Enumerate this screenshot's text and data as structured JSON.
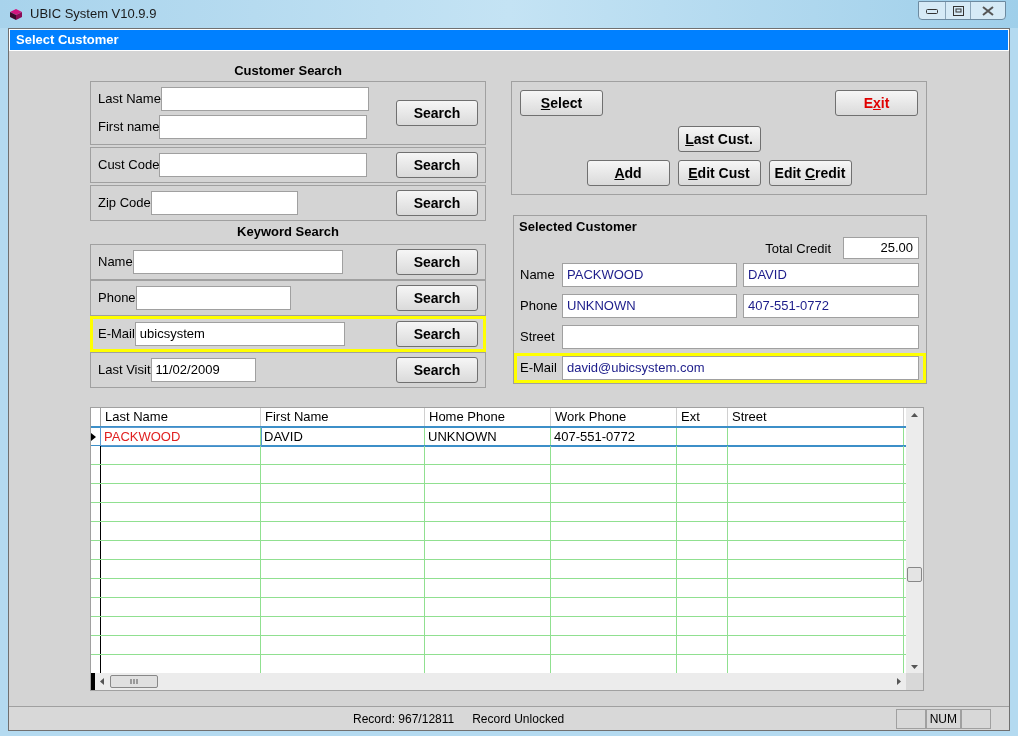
{
  "window": {
    "title": "UBIC System V10.9.9"
  },
  "form": {
    "title": "Select Customer"
  },
  "customer_search": {
    "title": "Customer Search",
    "groups": [
      {
        "fields": [
          {
            "label": "Last Name"
          },
          {
            "label": "First name"
          }
        ],
        "button": "Search",
        "highlighted": false
      },
      {
        "fields": [
          {
            "label": "Cust Code"
          }
        ],
        "button": "Search",
        "highlighted": false
      },
      {
        "fields": [
          {
            "label": "Zip Code"
          }
        ],
        "button": "Search",
        "highlighted": false
      }
    ]
  },
  "keyword_search": {
    "title": "Keyword Search",
    "groups": [
      {
        "fields": [
          {
            "label": "Name"
          }
        ],
        "button": "Search",
        "highlighted": false
      },
      {
        "fields": [
          {
            "label": "Phone"
          }
        ],
        "button": "Search",
        "highlighted": false
      },
      {
        "fields": [
          {
            "label": "E-Mail",
            "value": "ubicsystem"
          }
        ],
        "button": "Search",
        "highlighted": true
      },
      {
        "fields": [
          {
            "label": "Last Visit",
            "value": "11/02/2009"
          }
        ],
        "button": "Search",
        "highlighted": false
      }
    ]
  },
  "actions": {
    "rows": [
      [
        {
          "label": {
            "key": "S",
            "after": "elect"
          },
          "color": "#000000"
        },
        {
          "label": {
            "before": "E",
            "key": "x",
            "after": "it"
          },
          "color": "#e00000"
        }
      ],
      [
        {
          "label": {
            "key": "L",
            "after": "ast Cust."
          },
          "color": "#000000"
        }
      ],
      [
        {
          "label": {
            "key": "A",
            "after": "dd"
          },
          "color": "#000000"
        },
        {
          "label": {
            "key": "E",
            "after": "dit Cust"
          },
          "color": "#000000"
        },
        {
          "label": {
            "before": "Edit ",
            "key": "C",
            "after": "redit"
          },
          "color": "#000000"
        }
      ]
    ]
  },
  "selected_customer": {
    "title": "Selected Customer",
    "total_credit": {
      "label": "Total Credit",
      "value": "25.00"
    },
    "rows": [
      {
        "label": "Name",
        "kind": "split",
        "values": [
          "PACKWOOD",
          "DAVID"
        ],
        "highlighted": false
      },
      {
        "label": "Phone",
        "kind": "split",
        "values": [
          "UNKNOWN",
          "407-551-0772"
        ],
        "highlighted": false
      },
      {
        "label": "Street",
        "kind": "full",
        "highlighted": false
      },
      {
        "label": "E-Mail",
        "kind": "full",
        "values": [
          "david@ubicsystem.com"
        ],
        "highlighted": true
      }
    ]
  },
  "grid": {
    "columns": [
      "Last Name",
      "First Name",
      "Home Phone",
      "Work Phone",
      "Ext",
      "Street"
    ],
    "rows": [
      {
        "cells": [
          "PACKWOOD",
          "DAVID",
          "UNKNOWN",
          "407-551-0772"
        ],
        "selected": true
      }
    ]
  },
  "status_bar": {
    "texts": [
      "Record: 967/12811",
      "Record Unlocked"
    ],
    "indicators": [
      "NUM"
    ]
  }
}
